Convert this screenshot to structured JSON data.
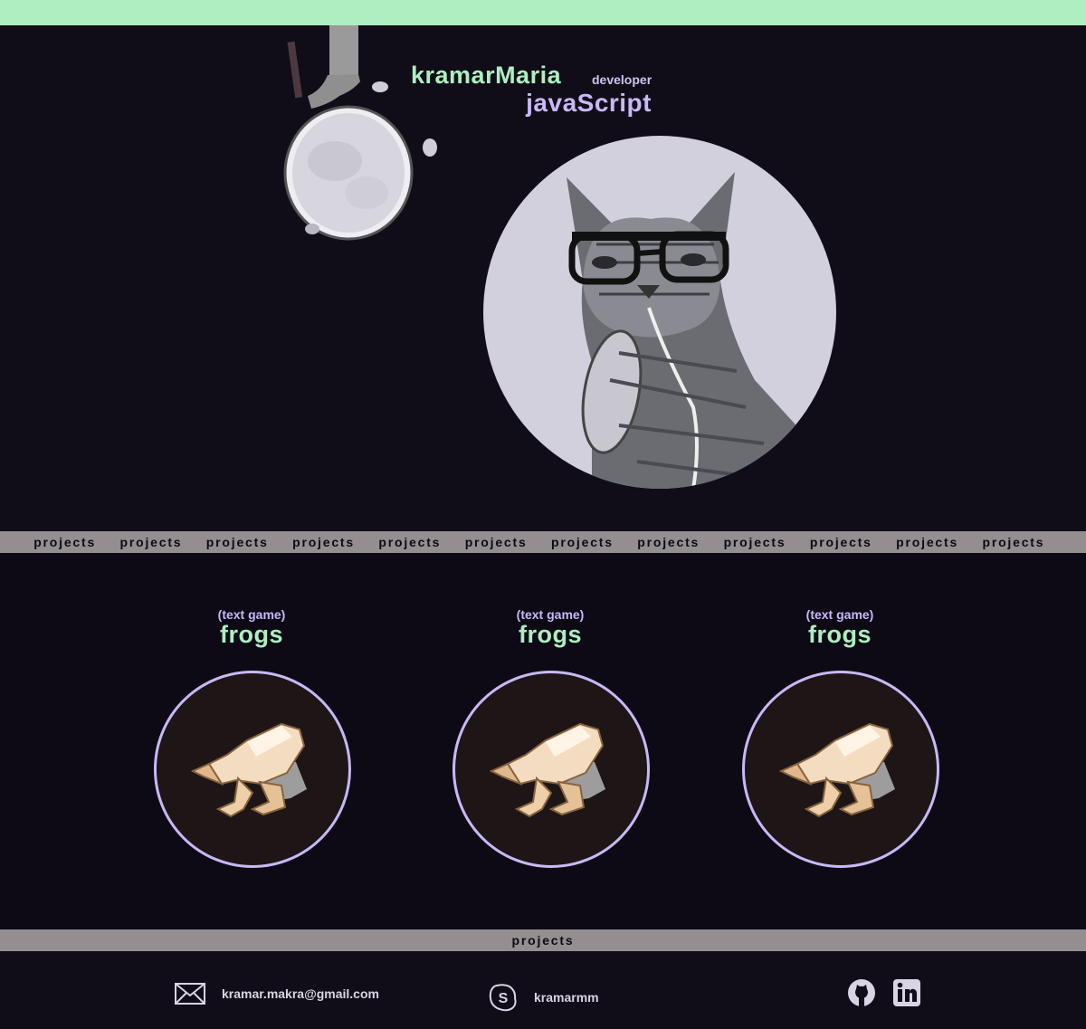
{
  "header": {
    "name": "kramarMaria",
    "role": "developer",
    "language": "javaScript"
  },
  "ticker_top": [
    "projects",
    "projects",
    "projects",
    "projects",
    "projects",
    "projects",
    "projects",
    "projects",
    "projects",
    "projects",
    "projects",
    "projects"
  ],
  "projects": [
    {
      "subtitle": "(text game)",
      "title": "frogs"
    },
    {
      "subtitle": "(text game)",
      "title": "frogs"
    },
    {
      "subtitle": "(text game)",
      "title": "frogs"
    }
  ],
  "ticker_bottom": "projects",
  "footer": {
    "email": "kramar.makra@gmail.com",
    "skype": "kramarmm"
  },
  "colors": {
    "accent_green": "#aeeec0",
    "accent_purple": "#c9b8f5",
    "background": "#100d19",
    "ticker_gray": "#948e91"
  },
  "icons": [
    "mail-icon",
    "skype-icon",
    "github-icon",
    "linkedin-icon"
  ]
}
